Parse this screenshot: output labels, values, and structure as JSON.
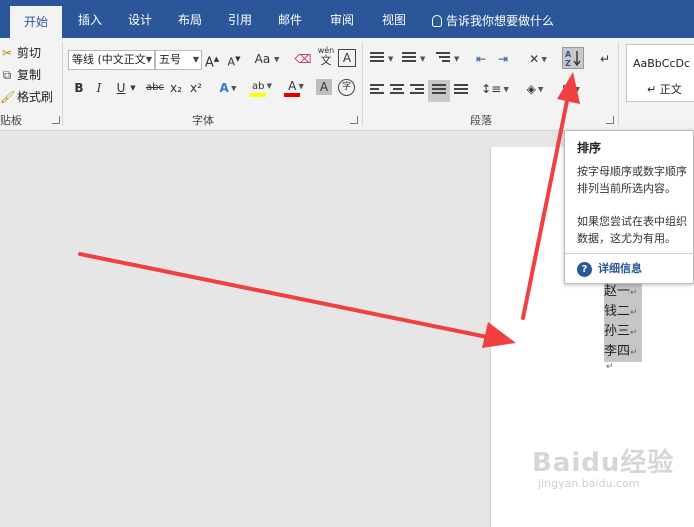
{
  "tabs": [
    "开始",
    "插入",
    "设计",
    "布局",
    "引用",
    "邮件",
    "审阅",
    "视图"
  ],
  "tell_me": "告诉我你想要做什么",
  "clipboard": {
    "cut": "剪切",
    "copy": "复制",
    "format_painter": "格式刷",
    "group_label": "贴板"
  },
  "font": {
    "font_name": "等线 (中文正文",
    "font_size": "五号",
    "grow": "A",
    "shrink": "A",
    "change_case": "Aa",
    "phonetic": "wén",
    "phonetic_char": "文",
    "border_char": "A",
    "bold": "B",
    "italic": "I",
    "underline": "U",
    "strike": "abc",
    "subscript": "x₂",
    "superscript": "x²",
    "effects": "A",
    "highlight": "ab",
    "font_color": "A",
    "shading_char": "A",
    "enclose_char": "字",
    "group_label": "字体"
  },
  "paragraph": {
    "group_label": "段落"
  },
  "styles": {
    "sample": "AaBbCcDc",
    "name": "正文"
  },
  "document": {
    "lines": [
      "赵一",
      "钱二",
      "孙三",
      "李四"
    ],
    "paragraph_mark": "↵"
  },
  "tooltip": {
    "title": "排序",
    "line1": "按字母顺序或数字顺序排列当前所选内容。",
    "line2": "如果您尝试在表中组织数据，这尤为有用。",
    "more": "详细信息"
  },
  "watermark": {
    "brand": "Baidu经验",
    "url": "jingyan.baidu.com"
  },
  "colors": {
    "tab_bar": "#2b579a",
    "ribbon": "#f3f3f3",
    "arrow": "#f04040",
    "highlight_yellow": "#ffff00",
    "font_red": "#e00000"
  }
}
